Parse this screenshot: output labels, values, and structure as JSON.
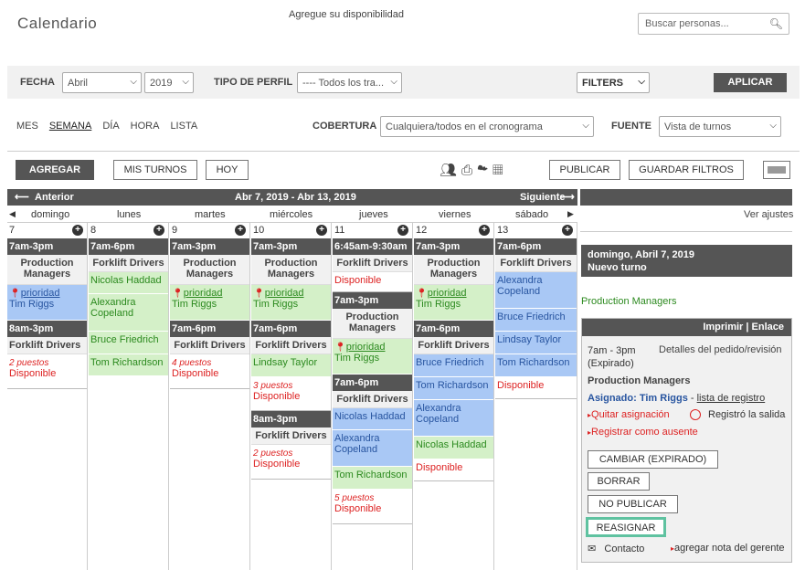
{
  "header": {
    "title": "Calendario",
    "availability": "Agregue su disponibilidad",
    "search_placeholder": "Buscar personas..."
  },
  "filters": {
    "fecha_label": "FECHA",
    "month": "Abril",
    "year": "2019",
    "tipo_label": "TIPO DE PERFIL",
    "tipo_value": "---- Todos los tra...",
    "filters_btn": "FILTERS",
    "apply": "APLICAR"
  },
  "views": {
    "mes": "MES",
    "semana": "SEMANA",
    "dia": "DÍA",
    "hora": "HORA",
    "lista": "LISTA",
    "cobertura_label": "COBERTURA",
    "cobertura_value": "Cualquiera/todos en el cronograma",
    "fuente_label": "FUENTE",
    "fuente_value": "Vista de turnos"
  },
  "toolbar": {
    "agregar": "AGREGAR",
    "mis_turnos": "MIS TURNOS",
    "hoy": "HOY",
    "publicar": "PUBLICAR",
    "guardar": "GUARDAR FILTROS"
  },
  "calendar": {
    "prev": "Anterior",
    "range": "Abr 7, 2019 - Abr 13, 2019",
    "next": "Siguiente",
    "days": [
      "domingo",
      "lunes",
      "martes",
      "miércoles",
      "jueves",
      "viernes",
      "sábado"
    ],
    "nums": [
      "7",
      "8",
      "9",
      "10",
      "11",
      "12",
      "13"
    ]
  },
  "text": {
    "t73": "7am-3pm",
    "t76": "7am-6pm",
    "t83": "8am-3pm",
    "t645": "6:45am-9:30am",
    "pm": "Production Managers",
    "fd": "Forklift Drivers",
    "prioridad": "prioridad",
    "tim": "Tim Riggs",
    "nicolas": "Nicolas Haddad",
    "alexandra": "Alexandra Copeland",
    "bruce": "Bruce Friedrich",
    "tom": "Tom Richardson",
    "lindsay": "Lindsay Taylor",
    "disp": "Disponible",
    "p2": "2 puestos",
    "p3": "3 puestos",
    "p4": "4 puestos",
    "p5": "5 puestos"
  },
  "panel": {
    "ver_ajustes": "Ver ajustes",
    "date": "domingo, Abril 7, 2019",
    "nuevo": "Nuevo turno",
    "group": "Production Managers",
    "imprimir": "Imprimir",
    "enlace": "Enlace",
    "time": "7am - 3pm",
    "expired": "(Expirado)",
    "detalles": "Detalles del pedido/revisión",
    "position": "Production Managers",
    "asignado_label": "Asignado:",
    "asignado": "Tim Riggs",
    "lista": "lista de registro",
    "quitar": "Quitar asignación",
    "registro": "Registró la salida",
    "ausente": "Registrar como ausente",
    "cambiar": "CAMBIAR (EXPIRADO)",
    "borrar": "BORRAR",
    "no_publicar": "NO PUBLICAR",
    "reasignar": "REASIGNAR",
    "contacto": "Contacto",
    "nota": "agregar nota del gerente"
  }
}
